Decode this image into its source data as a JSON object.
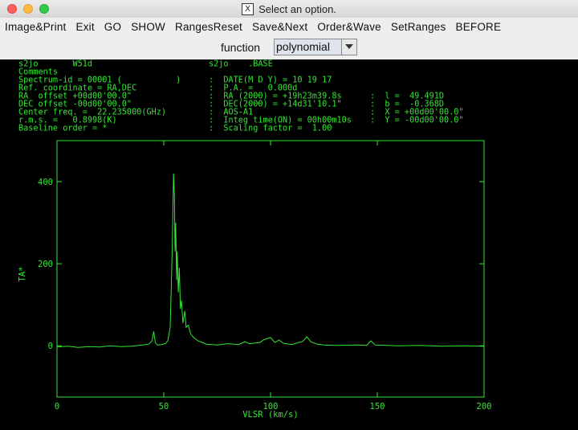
{
  "window": {
    "title": "Select an option.",
    "title_icon": "X"
  },
  "menu": [
    "Image&Print",
    "Exit",
    "GO",
    "SHOW",
    "RangesReset",
    "Save&Next",
    "Order&Wave",
    "SetRanges",
    "BEFORE"
  ],
  "function_bar": {
    "label": "function",
    "selected": "polynomial"
  },
  "header": {
    "row0": {
      "left": "s2jo       W51d",
      "right": "s2jo    .BASE"
    },
    "lines": [
      {
        "l": "Comments",
        "m": "",
        "r": ""
      },
      {
        "l": "Spectrum-id = 00001 (           )",
        "m": ":  DATE(M D Y) = 10 19 17",
        "r": ""
      },
      {
        "l": "Ref. coordinate = RA,DEC",
        "m": ":  P.A. =   0.000d",
        "r": ""
      },
      {
        "l": "RA  offset +00d00'00.0\"",
        "m": ":  RA (2000) = +19h23m39.8s",
        "r": ":  l =  49.491D"
      },
      {
        "l": "DEC offset -00d00'00.0\"",
        "m": ":  DEC(2000) = +14d31'10.1\"",
        "r": ":  b =  -0.368D"
      },
      {
        "l": "Center freq. =  22.235000(GHz)",
        "m": ":  AOS-A1",
        "r": ":  X = +00d00'00.0\""
      },
      {
        "l": "r.m.s. =   0.8998(K)",
        "m": ":  Integ time(ON) = 00h00m10s",
        "r": ":  Y = -00d00'00.0\""
      },
      {
        "l": "Baseline order = *",
        "m": ":  Scaling factor =  1.00",
        "r": ""
      }
    ]
  },
  "colors": {
    "plot": "#33e633",
    "background": "#000000",
    "menubar": "#eeeeee"
  },
  "chart_data": {
    "type": "line",
    "xlabel": "VLSR (km/s)",
    "ylabel": "TA*",
    "xlim": [
      0,
      200
    ],
    "ylim": [
      -125,
      500
    ],
    "xticks": [
      0,
      50,
      100,
      150,
      200
    ],
    "yticks": [
      0,
      200,
      400
    ],
    "series": [
      {
        "x": [
          0,
          5,
          10,
          15,
          20,
          25,
          30,
          35,
          40,
          43,
          44.5,
          45.3,
          46,
          47,
          49,
          51,
          52,
          53,
          53.5,
          54,
          54.3,
          54.6,
          55,
          55.3,
          55.6,
          56,
          56.3,
          56.8,
          57.3,
          57.8,
          58.3,
          59,
          59.8,
          60.5,
          61.5,
          62.5,
          64,
          66,
          68,
          70,
          75,
          80,
          85,
          88,
          90,
          95,
          97,
          100,
          102,
          104,
          106,
          110,
          113,
          115,
          117,
          119,
          122,
          125,
          130,
          140,
          145,
          147,
          149,
          155,
          160,
          170,
          180,
          190,
          200
        ],
        "y": [
          -3,
          -1,
          -4,
          -2,
          -3,
          0,
          -2,
          -1,
          2,
          4,
          12,
          35,
          8,
          2,
          3,
          6,
          14,
          45,
          140,
          240,
          330,
          420,
          360,
          230,
          300,
          160,
          230,
          130,
          190,
          90,
          110,
          55,
          85,
          45,
          50,
          30,
          20,
          12,
          8,
          4,
          2,
          5,
          3,
          10,
          5,
          8,
          15,
          20,
          8,
          14,
          6,
          3,
          8,
          10,
          22,
          9,
          4,
          2,
          1,
          2,
          1,
          12,
          2,
          1,
          0,
          1,
          -1,
          0,
          -1
        ]
      }
    ]
  }
}
